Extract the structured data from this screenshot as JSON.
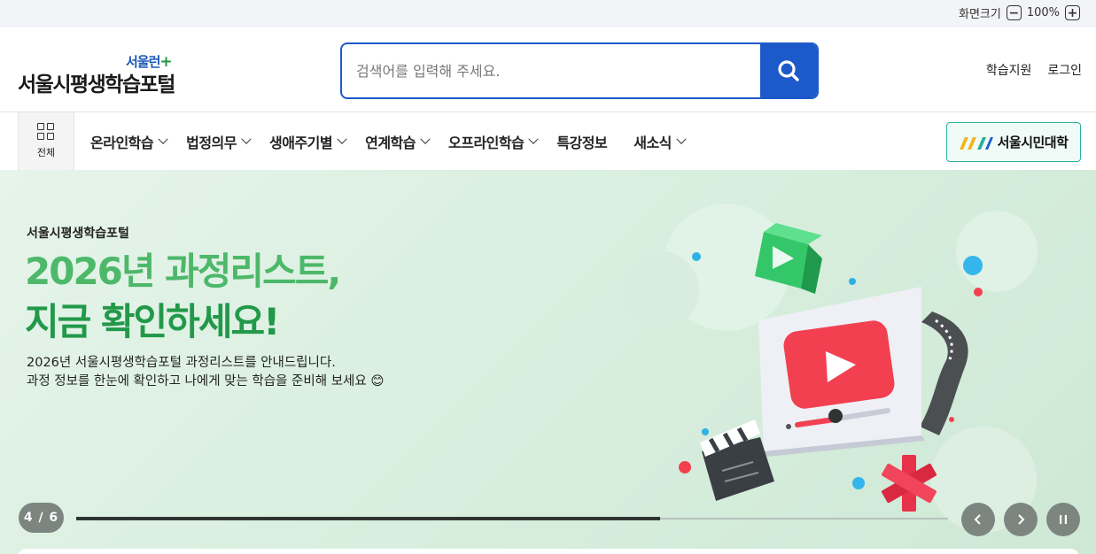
{
  "util": {
    "zoom_label": "화면크기",
    "zoom_value": "100%"
  },
  "header": {
    "logo_sub": "서울런",
    "logo_plus": "+",
    "logo_main": "서울시평생학습포털",
    "search_placeholder": "검색어를 입력해 주세요.",
    "links": [
      "학습지원",
      "로그인"
    ]
  },
  "gnb": {
    "all_label": "전체",
    "items": [
      {
        "label": "온라인학습",
        "has_sub": true
      },
      {
        "label": "법정의무",
        "has_sub": true
      },
      {
        "label": "생애주기별",
        "has_sub": true
      },
      {
        "label": "연계학습",
        "has_sub": true
      },
      {
        "label": "오프라인학습",
        "has_sub": true
      },
      {
        "label": "특강정보",
        "has_sub": false
      },
      {
        "label": "새소식",
        "has_sub": true
      }
    ],
    "citizen_label": "서울시민대학"
  },
  "hero": {
    "eyebrow": "서울시평생학습포털",
    "headline_line1": "2026년 과정리스트,",
    "headline_line2": "지금 확인하세요!",
    "desc_line1": "2026년 서울시평생학습포털 과정리스트를 안내드립니다.",
    "desc_line2": "과정 정보를 한눈에 확인하고 나에게 맞는 학습을 준비해 보세요 😊",
    "slide_counter": "4 / 6",
    "slide_current": 4,
    "slide_total": 6,
    "progress": 0.67
  },
  "colors": {
    "brand_blue": "#1d5ac9",
    "brand_green": "#22994a",
    "control_gray": "#7d8581"
  },
  "icons": [
    "zoom-out-icon",
    "zoom-in-icon",
    "search-icon",
    "grid-menu-icon",
    "chevron-down-icon",
    "citizen-logo-icon",
    "prev-icon",
    "next-icon",
    "pause-icon"
  ]
}
